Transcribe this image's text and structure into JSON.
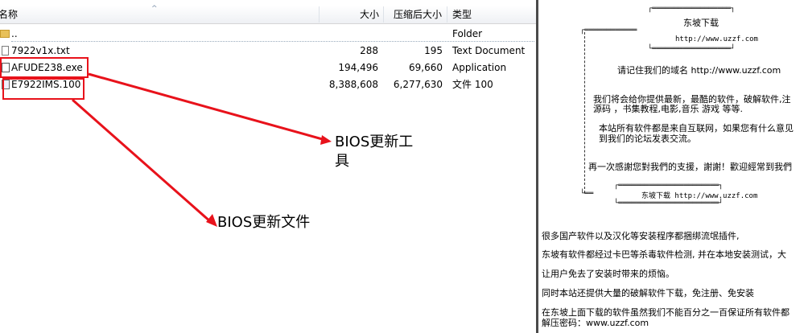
{
  "columns": {
    "name": "名称",
    "size": "大小",
    "packed": "压缩后大小",
    "type": "类型"
  },
  "rows": [
    {
      "name": "..",
      "size": "",
      "packed": "",
      "type": "Folder"
    },
    {
      "name": "7922v1x.txt",
      "size": "288",
      "packed": "195",
      "type": "Text Document"
    },
    {
      "name": "AFUDE238.exe",
      "size": "194,496",
      "packed": "69,660",
      "type": "Application"
    },
    {
      "name": "E7922IMS.100",
      "size": "8,388,608",
      "packed": "6,277,630",
      "type": "文件 100"
    }
  ],
  "annotations": {
    "tool_line1": "BIOS更新工",
    "tool_line2": "具",
    "file": "BIOS更新文件"
  },
  "readme": {
    "title": "东坡下载",
    "url_top": "http://www.uzzf.com",
    "remember": "请记住我们的域名 http://www.uzzf.com",
    "p1_line1": "我们将会给你提供最新，最酷的软件，破解软件,注",
    "p1_line2": "源码 ，书集教程,电影,音乐 游戏 等等.",
    "p2_line1": "本站所有软件都是来自互联网，如果您有什么意见",
    "p2_line2": "到我们的论坛发表交流。",
    "thanks": "再一次感謝您對我們的支援，謝謝！歡迎經常到我們",
    "footer_box": "东坡下载 http://www.uzzf.com",
    "line_a": "很多国产软件以及汉化等安装程序都捆绑流氓插件,",
    "line_b": "东坡有软件都经过卡巴等杀毒软件检测, 并在本地安装测试，大",
    "line_c": "让用户免去了安装时带来的烦恼。",
    "line_d": "同时本站还提供大量的破解软件下载，免注册、免安装",
    "line_e": "在东坡上面下载的软件虽然我们不能百分之一百保证所有软件都",
    "line_f": "解压密码：www.uzzf.com"
  },
  "colors": {
    "annotation_red": "#e8121b",
    "divider": "#4a4a4a"
  }
}
